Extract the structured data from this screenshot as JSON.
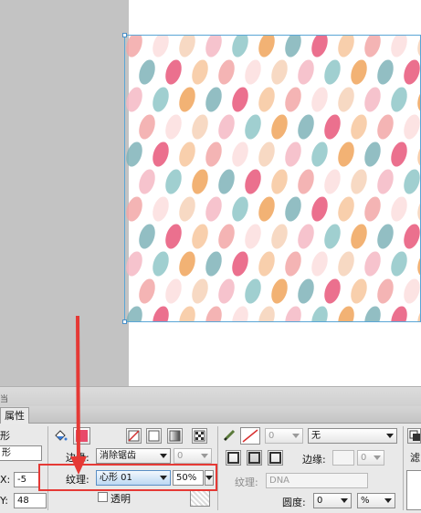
{
  "status": {
    "text": "当"
  },
  "panel": {
    "tab_label": "属性"
  },
  "left": {
    "shape_partial": "形",
    "shape_partial2": "形",
    "x_label": "X:",
    "x_value": "-5",
    "y_label": "Y:",
    "y_value": "48"
  },
  "fill": {
    "edge_label": "边缘:",
    "edge_value": "消除锯齿",
    "edge_amount": "0",
    "texture_label": "纹理:",
    "texture_value": "心形 01",
    "texture_amount": "50%",
    "transparent_label": "透明"
  },
  "stroke": {
    "size_value": "0",
    "type_value": "无",
    "edge_label": "边缘:",
    "edge_value": "0",
    "texture_label": "纹理:",
    "texture_value": "DNA",
    "roundness_label": "圆度:",
    "roundness_value": "0",
    "roundness_unit": "%"
  },
  "filters": {
    "label_partial": "滤"
  },
  "colors": {
    "fill_swatch": "#e84a6a",
    "stroke_swatch": "#d83030",
    "highlight": "#e53935",
    "selection": "#5aa6d6",
    "arrow": "#e53935"
  }
}
